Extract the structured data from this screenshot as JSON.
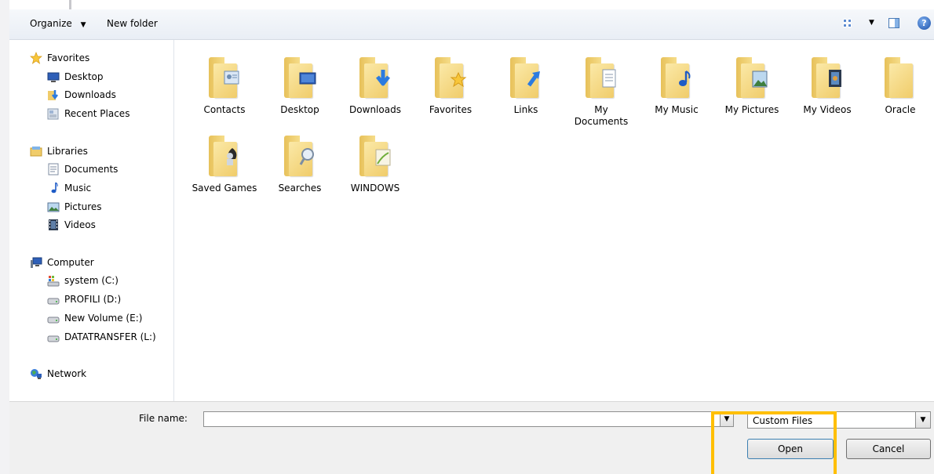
{
  "toolbar": {
    "organize_label": "Organize",
    "new_folder_label": "New folder",
    "help_glyph": "?"
  },
  "nav": {
    "favorites": {
      "header": "Favorites",
      "items": [
        "Desktop",
        "Downloads",
        "Recent Places"
      ]
    },
    "libraries": {
      "header": "Libraries",
      "items": [
        "Documents",
        "Music",
        "Pictures",
        "Videos"
      ]
    },
    "computer": {
      "header": "Computer",
      "items": [
        "system (C:)",
        "PROFILI (D:)",
        "New Volume (E:)",
        "DATATRANSFER (L:)"
      ]
    },
    "network": {
      "header": "Network"
    }
  },
  "folders": [
    {
      "label": "Contacts"
    },
    {
      "label": "Desktop"
    },
    {
      "label": "Downloads"
    },
    {
      "label": "Favorites"
    },
    {
      "label": "Links"
    },
    {
      "label": "My Documents"
    },
    {
      "label": "My Music"
    },
    {
      "label": "My Pictures"
    },
    {
      "label": "My Videos"
    },
    {
      "label": "Oracle"
    },
    {
      "label": "Saved Games"
    },
    {
      "label": "Searches"
    },
    {
      "label": "WINDOWS"
    }
  ],
  "bottom": {
    "file_name_label": "File name:",
    "file_name_value": "",
    "file_type_value": "Custom Files",
    "open_label": "Open",
    "cancel_label": "Cancel"
  },
  "colors": {
    "highlight": "#ffbf00",
    "folder": "#f0cc6a",
    "toolbar_bg": "#e9eef5",
    "footer_bg": "#f0f0f0"
  }
}
